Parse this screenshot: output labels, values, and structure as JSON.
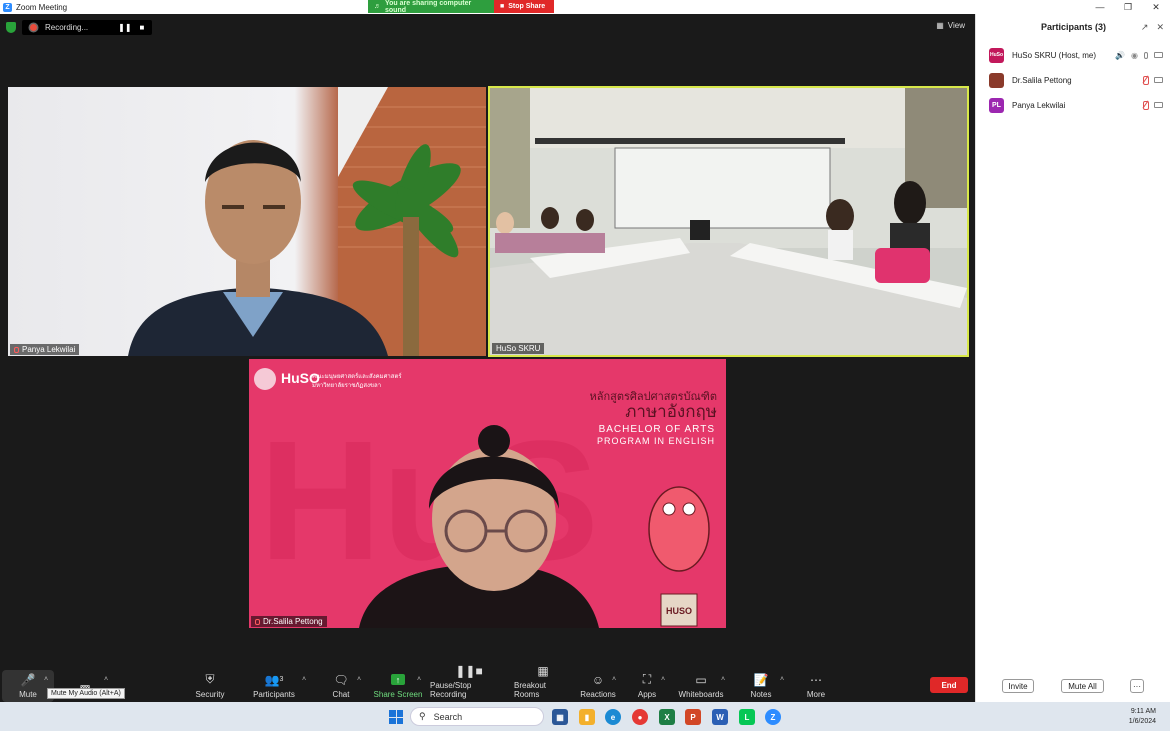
{
  "window": {
    "title": "Zoom Meeting"
  },
  "share_banner": {
    "sound_text": "You are sharing computer sound",
    "stop_label": "Stop Share"
  },
  "recording": {
    "label": "Recording..."
  },
  "view_label": "View",
  "tiles": [
    {
      "name": "Panya Lekwilai"
    },
    {
      "name": "HuSo SKRU"
    },
    {
      "name": "Dr.Salila Pettong"
    }
  ],
  "slide": {
    "org_line1": "คณะมนุษยศาสตร์และสังคมศาสตร์",
    "org_line2": "มหาวิทยาลัยราชภัฏสงขลา",
    "thai_line1": "หลักสูตรศิลปศาสตรบัณฑิต",
    "thai_line2": "ภาษาอังกฤษ",
    "en_line1": "BACHELOR OF ARTS",
    "en_line2": "PROGRAM IN ENGLISH",
    "logo_text": "HuSO",
    "mascot_bag": "HUSO"
  },
  "toolbar": {
    "mute": "Mute",
    "mute_tooltip": "Mute My Audio (Alt+A)",
    "security": "Security",
    "participants": "Participants",
    "participants_count": "3",
    "chat": "Chat",
    "share_screen": "Share Screen",
    "pause_stop_recording": "Pause/Stop Recording",
    "breakout_rooms": "Breakout Rooms",
    "reactions": "Reactions",
    "apps": "Apps",
    "whiteboards": "Whiteboards",
    "notes": "Notes",
    "more": "More",
    "end": "End"
  },
  "participants_panel": {
    "title": "Participants (3)",
    "people": [
      {
        "name": "HuSo SKRU (Host, me)",
        "avatar_text": "HuSo",
        "avatar_color": "#c2185b"
      },
      {
        "name": "Dr.Salila Pettong",
        "avatar_text": "",
        "avatar_color": "#8a3a2a"
      },
      {
        "name": "Panya Lekwilai",
        "avatar_text": "PL",
        "avatar_color": "#9c27b0"
      }
    ],
    "invite": "Invite",
    "mute_all": "Mute All",
    "more": "···"
  },
  "taskbar": {
    "search_placeholder": "Search",
    "time": "9:11 AM",
    "date": "1/6/2024"
  }
}
